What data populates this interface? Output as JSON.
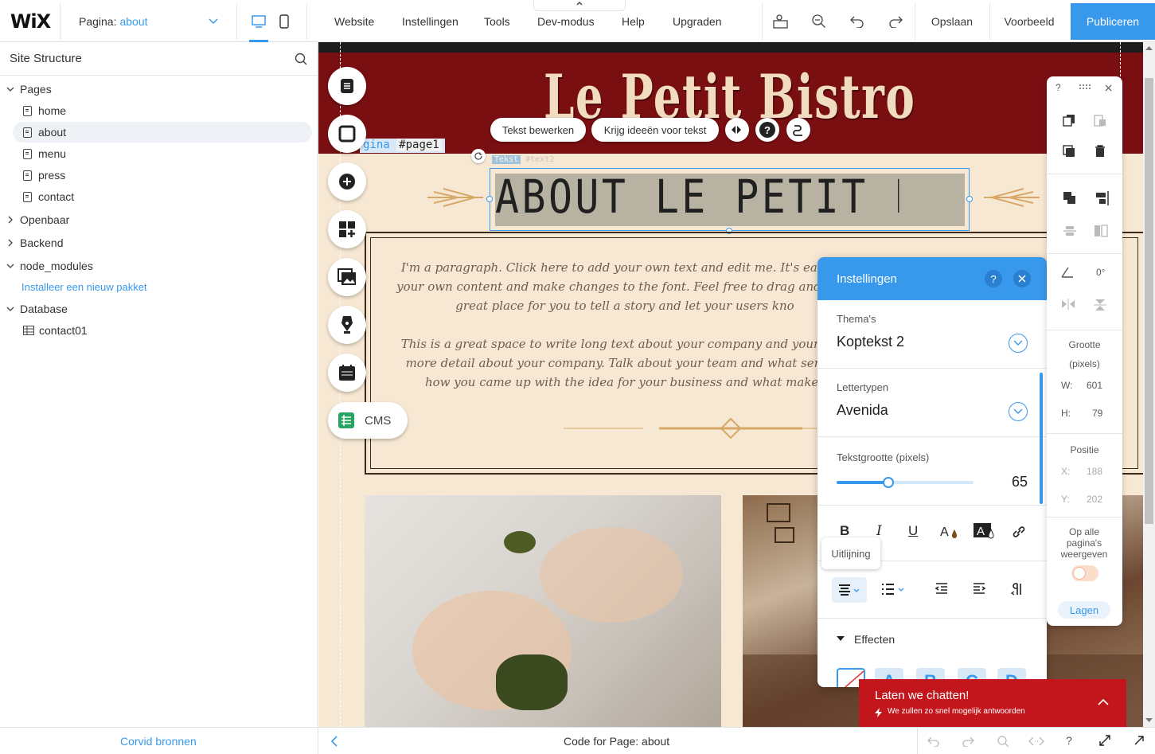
{
  "topbar": {
    "logo": "WiX",
    "page_label": "Pagina:",
    "page_value": "about",
    "menu": [
      "Website",
      "Instellingen",
      "Tools",
      "Dev-modus",
      "Help",
      "Upgraden"
    ],
    "save": "Opslaan",
    "preview": "Voorbeeld",
    "publish": "Publiceren"
  },
  "sidebar": {
    "title": "Site Structure",
    "pages_label": "Pages",
    "pages": [
      "home",
      "about",
      "menu",
      "press",
      "contact"
    ],
    "public": "Openbaar",
    "backend": "Backend",
    "node_modules": "node_modules",
    "install": "Installeer een nieuw pakket",
    "database": "Database",
    "collection": "contact01"
  },
  "bottombar": {
    "left": "Corvid bronnen",
    "center": "Code for Page: about"
  },
  "canvas": {
    "site_title": "Le Petit Bistro",
    "page_tag_label": "gina",
    "page_tag_id": "#page1",
    "text_tag_label": "Tekst",
    "text_tag_id": "#text2",
    "heading": "ABOUT LE PETIT BISTRO",
    "para1": [
      "I'm a paragraph. Click here to add your own text and edit me. It's easy. Ju",
      "your own content and make changes to the font. Feel free to drag and drop",
      "great place for you to tell a story and let your users kno"
    ],
    "para2": [
      "This is a great space to write long text about your company and your serv",
      "more detail about your company. Talk about your team and what service",
      "how you came up with the idea for your business and what makes"
    ]
  },
  "context": {
    "edit_text": "Tekst bewerken",
    "ideas": "Krijg ideeën voor tekst",
    "help": "?"
  },
  "tools": {
    "cms": "CMS"
  },
  "settings": {
    "title": "Instellingen",
    "help": "?",
    "themes_label": "Thema's",
    "themes_value": "Koptekst 2",
    "fonts_label": "Lettertypen",
    "fonts_value": "Avenida",
    "size_label": "Tekstgrootte (pixels)",
    "size_value": "65",
    "size_level": 0.38,
    "bold": "B",
    "italic": "I",
    "underline": "U",
    "align_tooltip": "Uitlijning",
    "effects": "Effecten",
    "effect_letters": [
      "A",
      "B",
      "C",
      "D"
    ]
  },
  "rpanel": {
    "help": "?",
    "rotation": "0°",
    "size_label": "Grootte",
    "size_unit": "(pixels)",
    "w_label": "W:",
    "w_val": "601",
    "h_label": "H:",
    "h_val": "79",
    "pos_label": "Positie",
    "x_label": "X:",
    "x_val": "188",
    "y_label": "Y:",
    "y_val": "202",
    "all_pages": "Op alle pagina's weergeven",
    "layers": "Lagen"
  },
  "chat": {
    "title": "Laten we chatten!",
    "subtitle": "We zullen zo snel mogelijk antwoorden"
  },
  "colors": {
    "accent": "#3899ec",
    "header_red": "#7a0f12",
    "chat_red": "#c3161c"
  }
}
